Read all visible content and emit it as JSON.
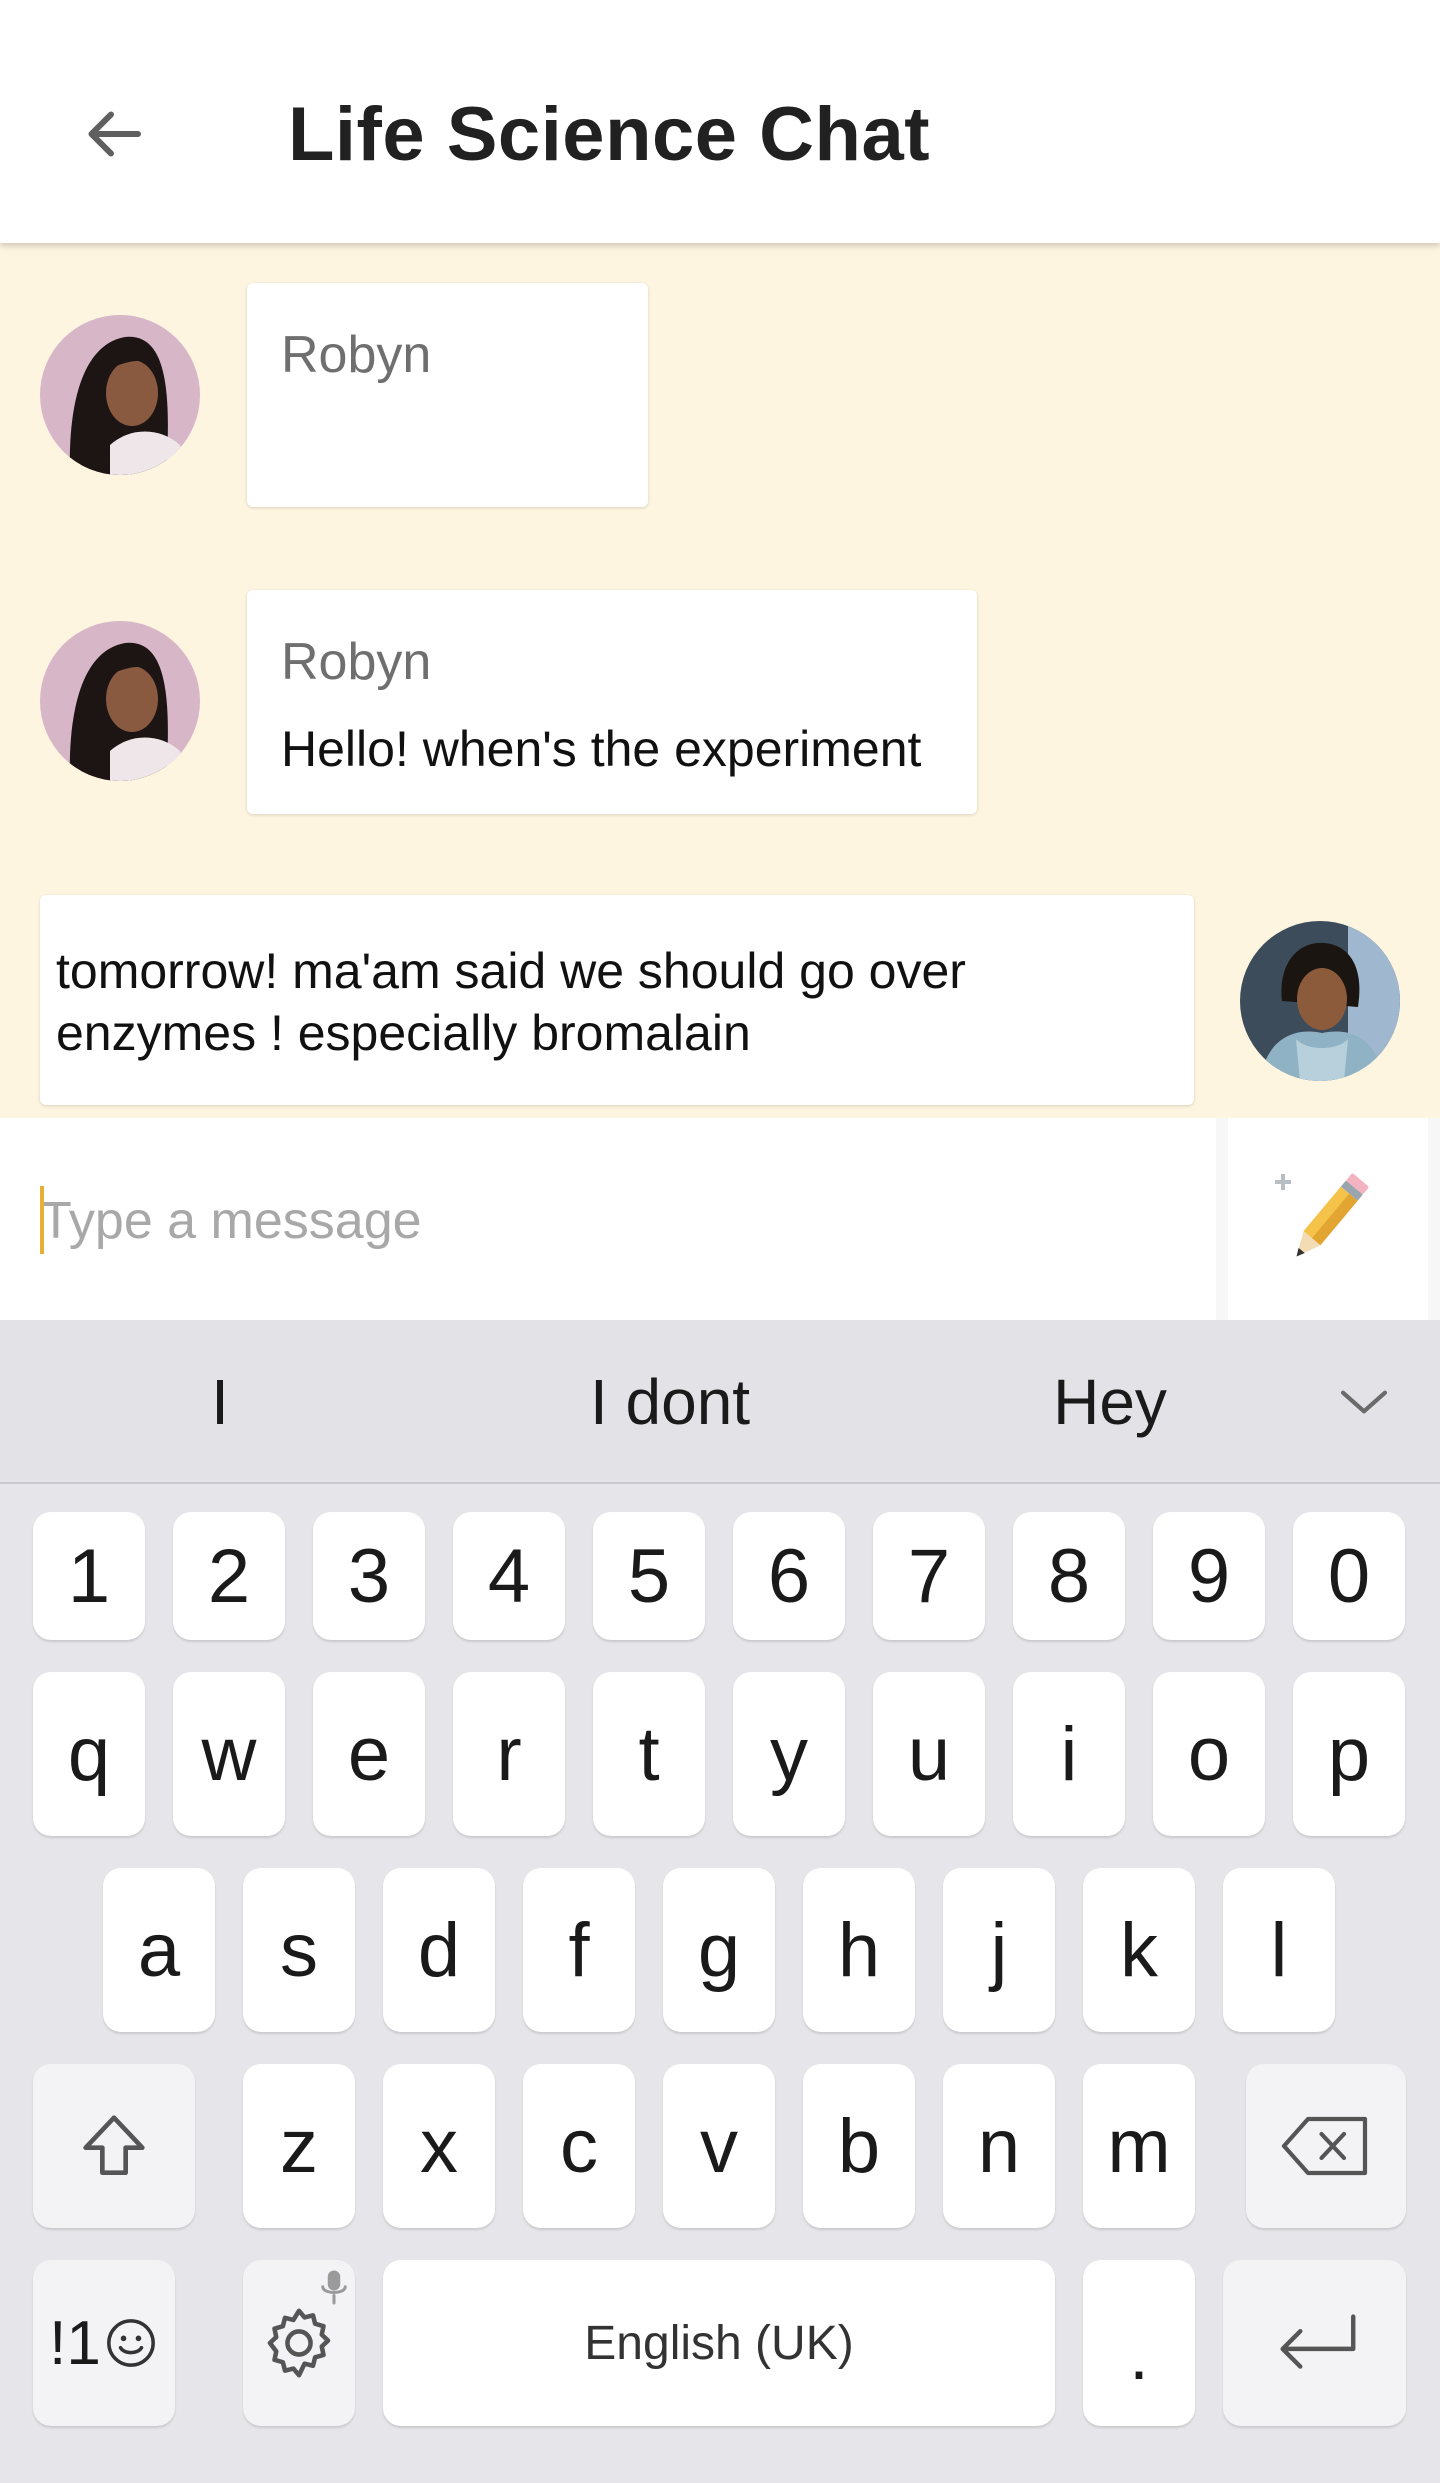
{
  "app_bar": {
    "back_icon": "arrow-left-icon",
    "title": "Life Science Chat"
  },
  "messages": [
    {
      "sender": "Robyn",
      "text": "",
      "avatar_icon": "robyn-avatar"
    },
    {
      "sender": "Robyn",
      "text": "Hello! when's the experiment",
      "avatar_icon": "robyn-avatar"
    },
    {
      "text": "tomorrow! ma'am said we should go over enzymes ! especially bromalain",
      "avatar_icon": "own-avatar"
    }
  ],
  "composer": {
    "placeholder": "Type a message",
    "value": "",
    "send_icon": "pencil-icon"
  },
  "keyboard": {
    "suggestions": [
      "I",
      "I dont",
      "Hey"
    ],
    "expand_icon": "chevron-down-icon",
    "number_row": [
      "1",
      "2",
      "3",
      "4",
      "5",
      "6",
      "7",
      "8",
      "9",
      "0"
    ],
    "row1": [
      "q",
      "w",
      "e",
      "r",
      "t",
      "y",
      "u",
      "i",
      "o",
      "p"
    ],
    "row2": [
      "a",
      "s",
      "d",
      "f",
      "g",
      "h",
      "j",
      "k",
      "l"
    ],
    "row3": [
      "z",
      "x",
      "c",
      "v",
      "b",
      "n",
      "m"
    ],
    "shift_icon": "shift-icon",
    "backspace_icon": "backspace-icon",
    "symbols_label": "!1",
    "emoji_icon": "smiley-icon",
    "settings_icon": "gear-icon",
    "mic_icon": "mic-icon",
    "space_label": "English (UK)",
    "period_label": ".",
    "enter_icon": "enter-icon"
  },
  "colors": {
    "chat_background": "#fdf5df",
    "keyboard_background": "#e6e6ea",
    "caret": "#e5b033"
  }
}
